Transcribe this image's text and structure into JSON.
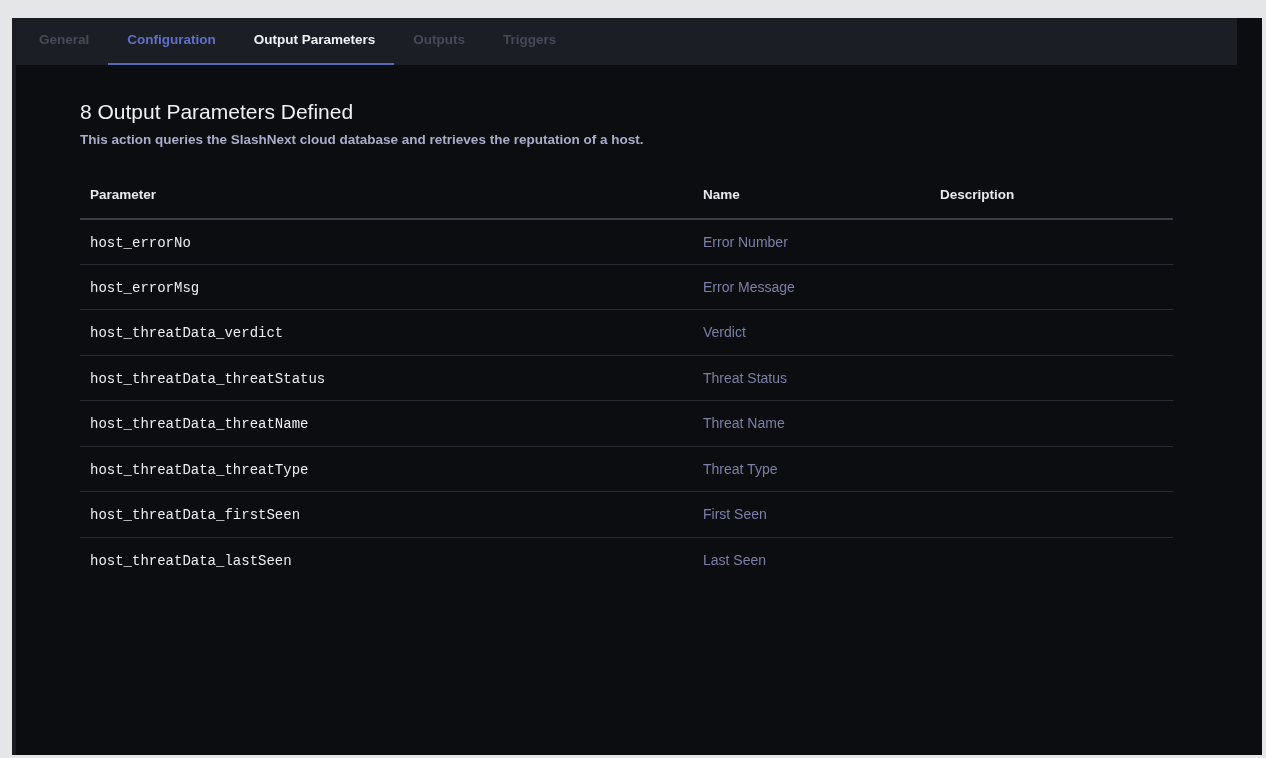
{
  "tabs": [
    {
      "label": "General",
      "selected": false,
      "hovered": false
    },
    {
      "label": "Configuration",
      "selected": false,
      "hovered": true
    },
    {
      "label": "Output Parameters",
      "selected": true,
      "hovered": false
    },
    {
      "label": "Outputs",
      "selected": false,
      "hovered": false
    },
    {
      "label": "Triggers",
      "selected": false,
      "hovered": false
    }
  ],
  "heading": "8 Output Parameters Defined",
  "description": "This action queries the SlashNext cloud database and retrieves the reputation of a host.",
  "table": {
    "columns": [
      "Parameter",
      "Name",
      "Description"
    ],
    "rows": [
      {
        "parameter": "host_errorNo",
        "name": "Error Number"
      },
      {
        "parameter": "host_errorMsg",
        "name": "Error Message"
      },
      {
        "parameter": "host_threatData_verdict",
        "name": "Verdict"
      },
      {
        "parameter": "host_threatData_threatStatus",
        "name": "Threat Status"
      },
      {
        "parameter": "host_threatData_threatName",
        "name": "Threat Name"
      },
      {
        "parameter": "host_threatData_threatType",
        "name": "Threat Type"
      },
      {
        "parameter": "host_threatData_firstSeen",
        "name": "First Seen"
      },
      {
        "parameter": "host_threatData_lastSeen",
        "name": "Last Seen"
      }
    ]
  }
}
